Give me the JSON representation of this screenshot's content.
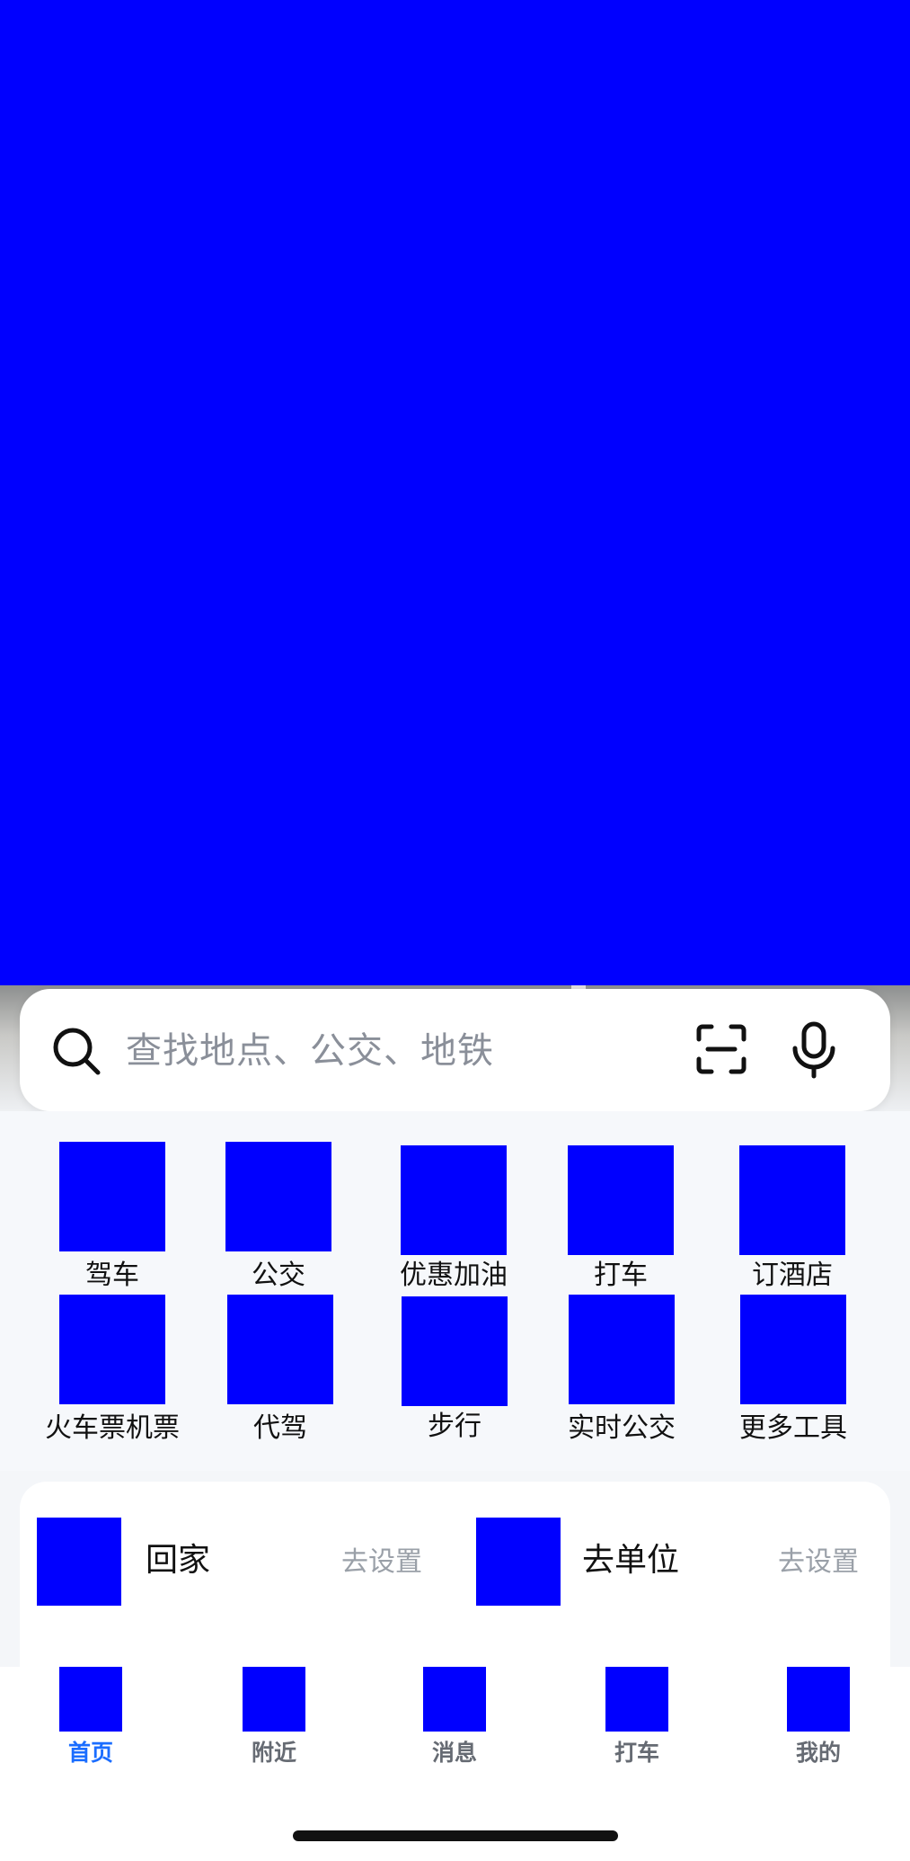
{
  "search": {
    "placeholder": "查找地点、公交、地铁",
    "icons": [
      "search-icon",
      "scan-icon",
      "microphone-icon"
    ]
  },
  "tools": [
    {
      "label": "驾车",
      "icon": "car-icon"
    },
    {
      "label": "公交",
      "icon": "bus-icon"
    },
    {
      "label": "优惠加油",
      "icon": "fuel-icon"
    },
    {
      "label": "打车",
      "icon": "taxi-icon"
    },
    {
      "label": "订酒店",
      "icon": "hotel-icon"
    },
    {
      "label": "火车票机票",
      "icon": "train-ticket-icon"
    },
    {
      "label": "代驾",
      "icon": "designated-driver-icon"
    },
    {
      "label": "步行",
      "icon": "walk-icon"
    },
    {
      "label": "实时公交",
      "icon": "realtime-bus-icon"
    },
    {
      "label": "更多工具",
      "icon": "more-tools-icon"
    }
  ],
  "favorites": [
    {
      "title": "回家",
      "action": "去设置",
      "icon": "home-icon"
    },
    {
      "title": "去单位",
      "action": "去设置",
      "icon": "office-icon"
    }
  ],
  "bottom_nav": [
    {
      "label": "首页",
      "active": true,
      "icon": "home-tab-icon"
    },
    {
      "label": "附近",
      "active": false,
      "icon": "nearby-tab-icon"
    },
    {
      "label": "消息",
      "active": false,
      "icon": "message-tab-icon"
    },
    {
      "label": "打车",
      "active": false,
      "icon": "taxi-tab-icon"
    },
    {
      "label": "我的",
      "active": false,
      "icon": "profile-tab-icon"
    }
  ],
  "colors": {
    "placeholder_fill": "#0000ff",
    "active_tab": "#1a6dff",
    "inactive_tab": "#666b73"
  }
}
